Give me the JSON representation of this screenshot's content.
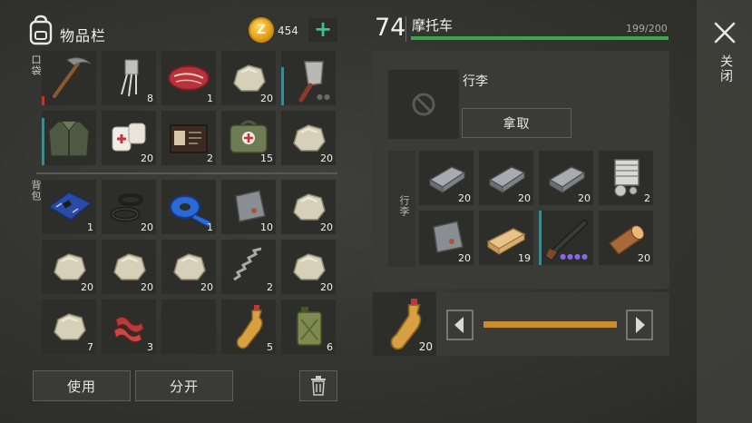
{
  "inventory": {
    "title": "物品栏",
    "coins": "454",
    "add_label": "+",
    "pocket_label": "口袋",
    "backpack_label": "背包"
  },
  "pocket_items": [
    {
      "icon": "pickaxe-icon",
      "count": ""
    },
    {
      "icon": "transistor-icon",
      "count": "8"
    },
    {
      "icon": "raw-meat-icon",
      "count": "1"
    },
    {
      "icon": "stone-icon",
      "count": "20"
    },
    {
      "icon": "cleaver-icon",
      "count": ""
    },
    {
      "icon": "jacket-icon",
      "count": ""
    },
    {
      "icon": "bandage-icon",
      "count": "20"
    },
    {
      "icon": "wallet-icon",
      "count": "2"
    },
    {
      "icon": "first-aid-bag-icon",
      "count": "15"
    },
    {
      "icon": "stone-icon",
      "count": "20"
    }
  ],
  "backpack_items": [
    {
      "icon": "circuit-board-icon",
      "count": "1"
    },
    {
      "icon": "rubber-rings-icon",
      "count": "20"
    },
    {
      "icon": "tape-icon",
      "count": "1"
    },
    {
      "icon": "metal-plate-icon",
      "count": "10"
    },
    {
      "icon": "stone-icon",
      "count": "20"
    },
    {
      "icon": "stone-icon",
      "count": "20"
    },
    {
      "icon": "stone-icon",
      "count": "20"
    },
    {
      "icon": "stone-icon",
      "count": "20"
    },
    {
      "icon": "spring-icon",
      "count": "2"
    },
    {
      "icon": "stone-icon",
      "count": "20"
    },
    {
      "icon": "stone-icon",
      "count": "7"
    },
    {
      "icon": "bacon-icon",
      "count": "3"
    },
    {
      "icon": "empty",
      "count": ""
    },
    {
      "icon": "bottle-icon",
      "count": "5"
    },
    {
      "icon": "jerrycan-icon",
      "count": "6"
    }
  ],
  "actions": {
    "use": "使用",
    "split": "分开"
  },
  "vehicle": {
    "level": "74",
    "name": "摩托车",
    "hp": "199/200",
    "hp_fraction": 0.995,
    "luggage_title": "行李",
    "take_label": "拿取",
    "luggage_side_label": "行李"
  },
  "luggage_items": [
    {
      "icon": "iron-ingot-icon",
      "count": "20"
    },
    {
      "icon": "iron-ingot-icon",
      "count": "20"
    },
    {
      "icon": "iron-ingot-icon",
      "count": "20"
    },
    {
      "icon": "engine-part-icon",
      "count": "2"
    },
    {
      "icon": "metal-plate-icon",
      "count": "20"
    },
    {
      "icon": "wood-plank-icon",
      "count": "19"
    },
    {
      "icon": "shotgun-icon",
      "count": ""
    },
    {
      "icon": "log-icon",
      "count": "20"
    }
  ],
  "transfer": {
    "selected_icon": "bottle-icon",
    "selected_count": "20",
    "slider_fraction": 1.0
  },
  "close_label": "关闭",
  "colors": {
    "accent_green": "#33c49a",
    "hp_green": "#3aa84a",
    "slider_orange": "#c98d30",
    "durability_teal": "#3f8a8f",
    "durability_red": "#b83a2e"
  }
}
